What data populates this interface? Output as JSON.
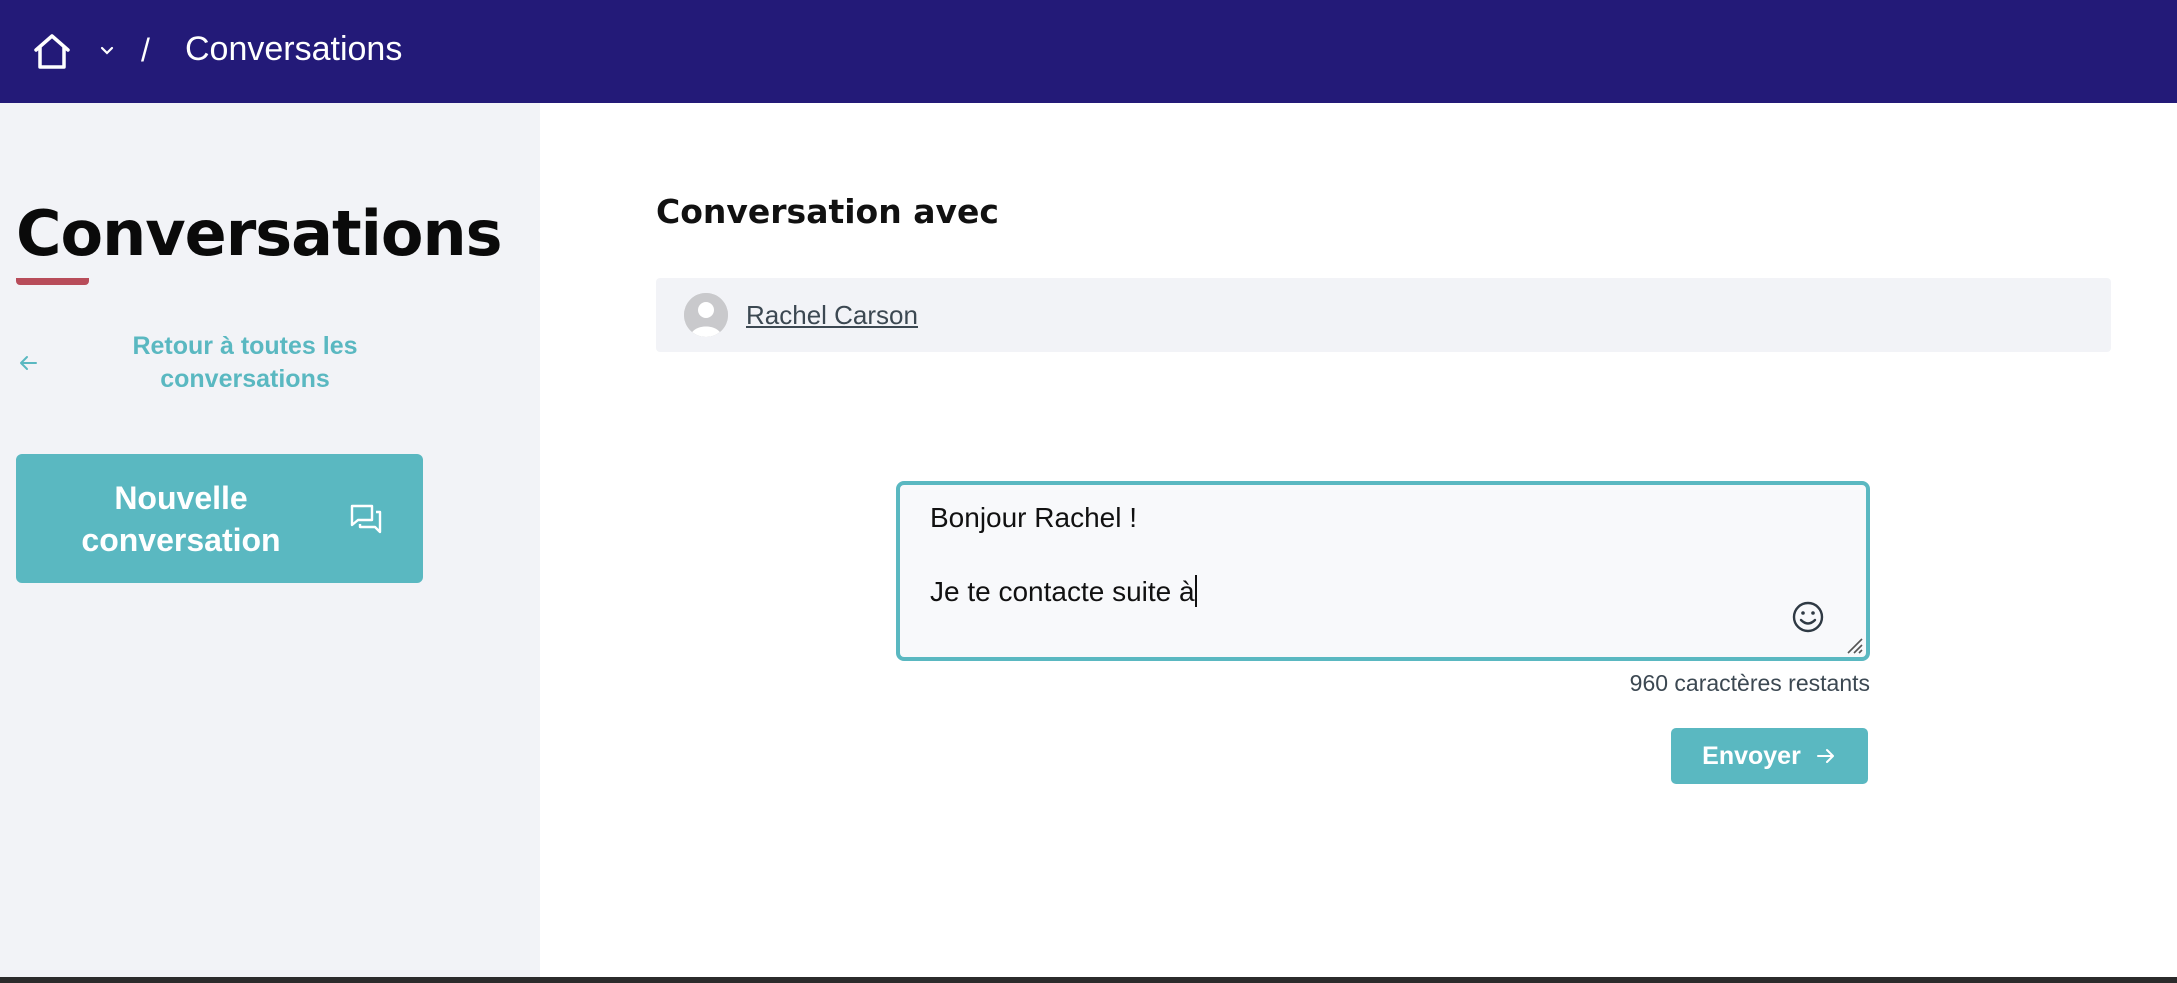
{
  "header": {
    "home_icon": "home-icon",
    "chevron_icon": "chevron-down-icon",
    "separator": "/",
    "current_page": "Conversations",
    "background_color": "#231a78"
  },
  "sidebar": {
    "title": "Conversations",
    "back_link_label": "Retour à toutes les conversations",
    "back_icon": "arrow-left-icon",
    "new_conversation_label": "Nouvelle conversation",
    "new_conversation_icon": "chat-bubbles-icon",
    "accent_color": "#5ab8c1",
    "underline_color": "#b84c5a"
  },
  "main": {
    "heading": "Conversation avec",
    "participant": {
      "name": "Rachel Carson",
      "avatar_icon": "user-avatar-icon"
    },
    "composer": {
      "value": "Bonjour Rachel !\n\nJe te contacte suite à",
      "emoji_icon": "smiley-icon",
      "remaining_chars": "960 caractères restants"
    },
    "send_label": "Envoyer",
    "send_icon": "arrow-right-icon"
  }
}
